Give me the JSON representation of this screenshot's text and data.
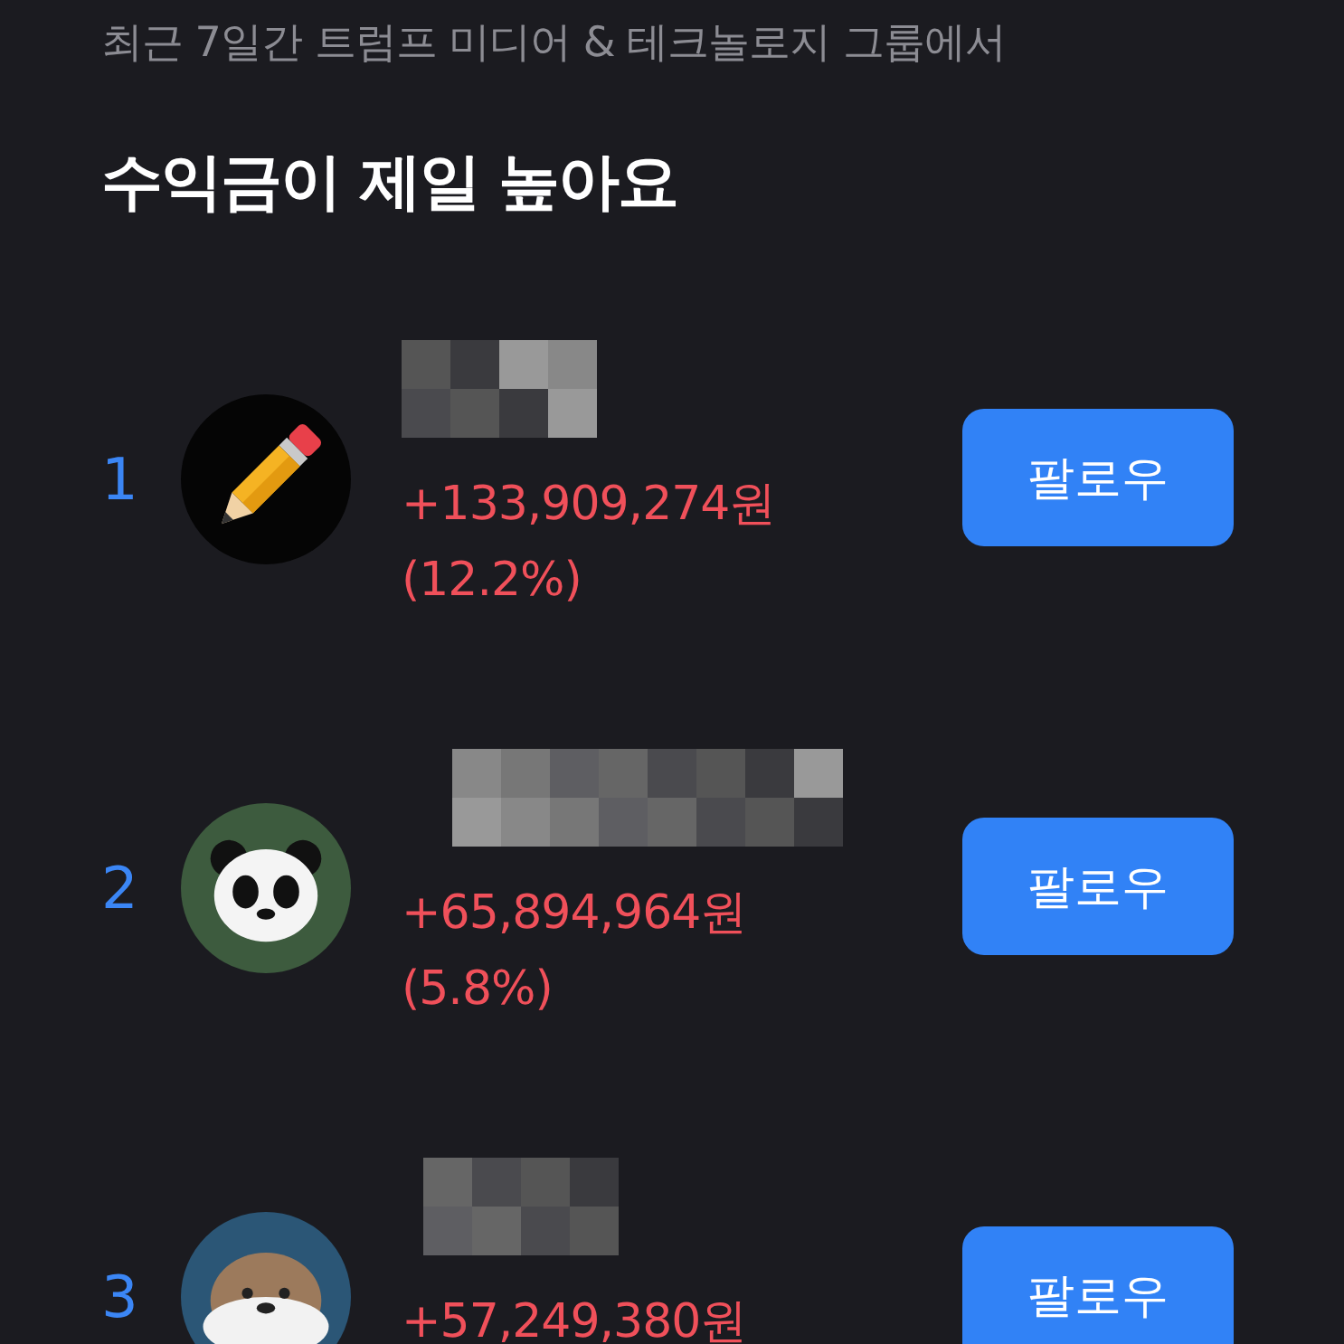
{
  "subtitle": "최근 7일간 트럼프 미디어 & 테크놀로지 그룹에서",
  "title": "수익금이 제일 높아요",
  "ranking": [
    {
      "rank": "1",
      "kind": "pencil",
      "amount": "+133,909,274원",
      "percent": "(12.2%)",
      "button": "팔로우"
    },
    {
      "rank": "2",
      "kind": "panda",
      "amount": "+65,894,964원",
      "percent": "(5.8%)",
      "button": "팔로우"
    },
    {
      "rank": "3",
      "kind": "otter",
      "amount": "+57,249,380원",
      "button": "팔로우"
    }
  ]
}
